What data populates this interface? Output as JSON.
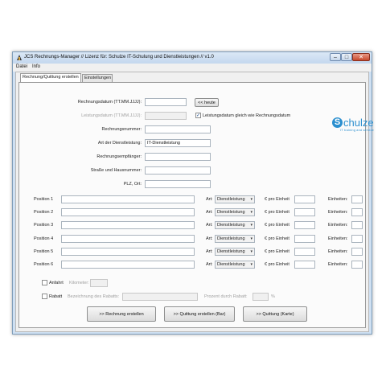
{
  "window": {
    "title": "JCS Rechnungs-Manager // Lizenz für: Schulze IT-Schulung und Dienstleistungen // v1.0",
    "min_symbol": "–",
    "max_symbol": "□",
    "close_symbol": "✕"
  },
  "menu": [
    "Datei",
    "Info"
  ],
  "tabs": [
    "Rechnung/Quittung erstellen",
    "Einstellungen"
  ],
  "logo": {
    "name": "chulze",
    "letter": "S",
    "tagline": "IT training and service",
    "color": "#2b8fcf"
  },
  "form": {
    "rechnungsdatum_label": "Rechnungsdatum (TT.MM.JJJJ):",
    "heute_button": "<< heute",
    "leistungsdatum_label": "Leistungsdatum (TT.MM.JJJJ):",
    "leistungsdatum_checkbox_label": "Leistungsdatum gleich wie Rechnungsdatum",
    "leistungsdatum_checked": "✓",
    "rechnungsnummer_label": "Rechnungsnummer:",
    "art_label": "Art der Dienstleistung:",
    "art_value": "IT-Dienstleistung",
    "empfaenger_label": "Rechnungsempfänger:",
    "strasse_label": "Straße und Hausnummer:",
    "plz_label": "PLZ, Ort:"
  },
  "positions": [
    {
      "label": "Position 1",
      "art_label": "Art:",
      "art_value": "Dienstleistung",
      "price_label": "€ pro Einheit",
      "units_label": "Einheiten:"
    },
    {
      "label": "Position 2",
      "art_label": "Art:",
      "art_value": "Dienstleistung",
      "price_label": "€ pro Einheit",
      "units_label": "Einheiten:"
    },
    {
      "label": "Position 3",
      "art_label": "Art:",
      "art_value": "Dienstleistung",
      "price_label": "€ pro Einheit",
      "units_label": "Einheiten:"
    },
    {
      "label": "Position 4",
      "art_label": "Art:",
      "art_value": "Dienstleistung",
      "price_label": "€ pro Einheit",
      "units_label": "Einheiten:"
    },
    {
      "label": "Position 5",
      "art_label": "Art:",
      "art_value": "Dienstleistung",
      "price_label": "€ pro Einheit",
      "units_label": "Einheiten:"
    },
    {
      "label": "Position 6",
      "art_label": "Art:",
      "art_value": "Dienstleistung",
      "price_label": "€ pro Einheit",
      "units_label": "Einheiten:"
    }
  ],
  "anfahrt": {
    "label": "Anfahrt",
    "km_label": "Kilometer:"
  },
  "rabatt": {
    "label": "Rabatt",
    "bez_label": "Bezeichnung des Rabatts:",
    "prozent_label": "Prozent durch Rabatt:",
    "percent_sign": "%"
  },
  "buttons": {
    "rechnung": ">> Rechnung erstellen",
    "quittung_bar": ">> Quittung erstellen (Bar)",
    "quittung_karte": ">> Quittung (Karte)"
  }
}
